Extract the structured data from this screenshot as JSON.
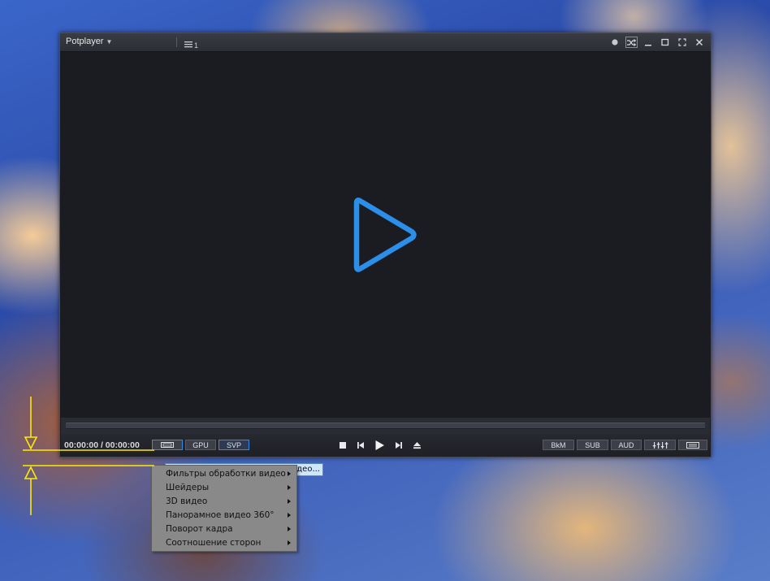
{
  "window": {
    "brand": "Potplayer",
    "playlist_badge": "1"
  },
  "controls": {
    "time_current": "00:00:00",
    "time_separator": "/",
    "time_total": "00:00:00",
    "left_chips": [
      "GPU",
      "SVP"
    ],
    "right_chips": [
      "BkM",
      "SUB",
      "AUD"
    ]
  },
  "tooltip": {
    "text": "део..."
  },
  "menu": {
    "items": [
      {
        "label": "Фильтры обработки видео"
      },
      {
        "label": "Шейдеры"
      },
      {
        "label": "3D видео"
      },
      {
        "label": "Панорамное видео 360°"
      },
      {
        "label": "Поворот кадра"
      },
      {
        "label": "Соотношение сторон"
      }
    ]
  },
  "colors": {
    "accent": "#2e8be6",
    "annotation": "#ffea00",
    "menu_bg": "#898989",
    "video_bg": "#1b1c22"
  },
  "icons": {
    "titlebar": [
      "dropdown-caret-icon",
      "playlist-icon",
      "record-dot-icon",
      "shuffle-icon",
      "minimize-icon",
      "maximize-icon",
      "fullscreen-icon",
      "close-icon"
    ],
    "transport": [
      "stop-icon",
      "previous-icon",
      "play-icon",
      "next-icon",
      "eject-icon"
    ],
    "right": [
      "equalizer-icon",
      "menu-list-icon"
    ]
  }
}
